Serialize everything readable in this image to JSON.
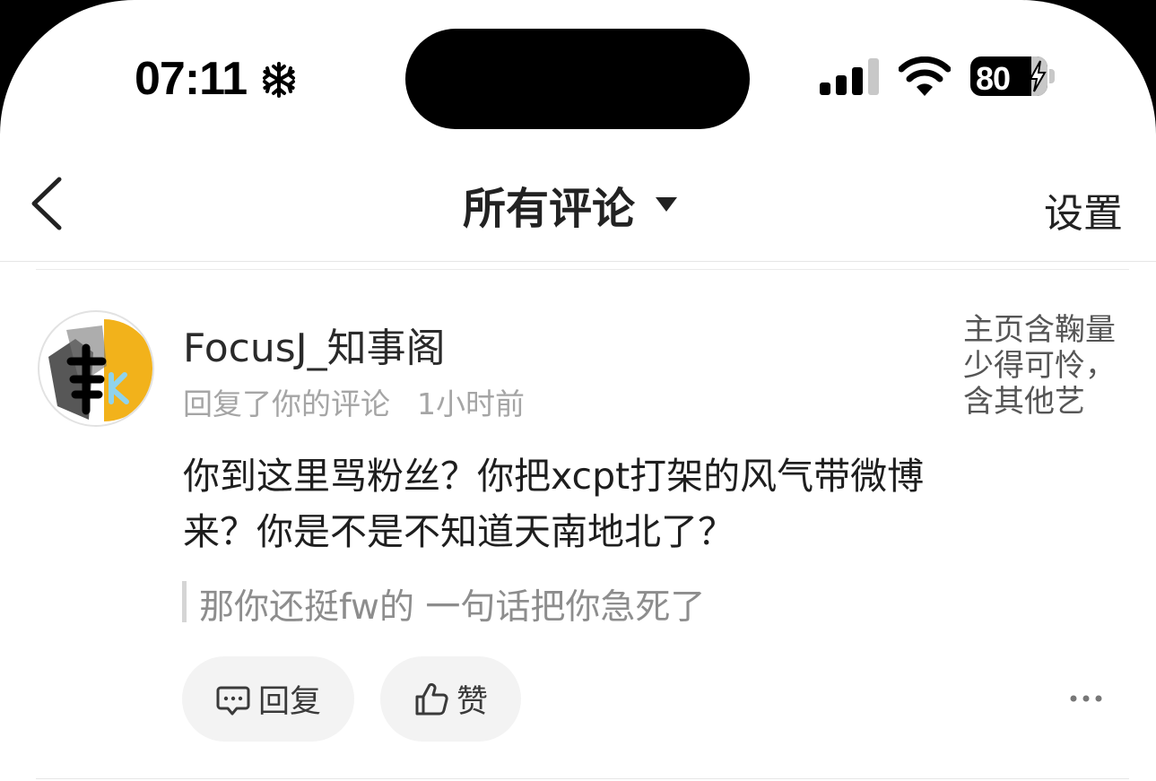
{
  "status_bar": {
    "time": "07:11",
    "battery": "80"
  },
  "nav": {
    "title": "所有评论",
    "settings_label": "设置"
  },
  "comment": {
    "username": "FocusJ_知事阁",
    "action": "回复了你的评论",
    "time_ago": "1小时前",
    "text": "你到这里骂粉丝？你把xcpt打架的风气带微博来？你是不是不知道天南地北了？",
    "quoted_text": "那你还挺fw的 一句话把你急死了",
    "post_preview": "主页含鞠量少得可怜，含其他艺",
    "reply_label": "回复",
    "like_label": "赞"
  },
  "icons": {
    "status": [
      "snowflake-icon",
      "signal-icon",
      "wifi-icon",
      "battery-icon"
    ],
    "nav": [
      "back-icon",
      "caret-down-icon"
    ],
    "actions": [
      "comment-icon",
      "thumbs-up-icon",
      "more-icon"
    ]
  },
  "colors": {
    "text_primary": "#1e1e1e",
    "text_secondary": "#a5a5a5",
    "button_bg": "#f3f3f3",
    "avatar_accent": "#f2b21b"
  }
}
